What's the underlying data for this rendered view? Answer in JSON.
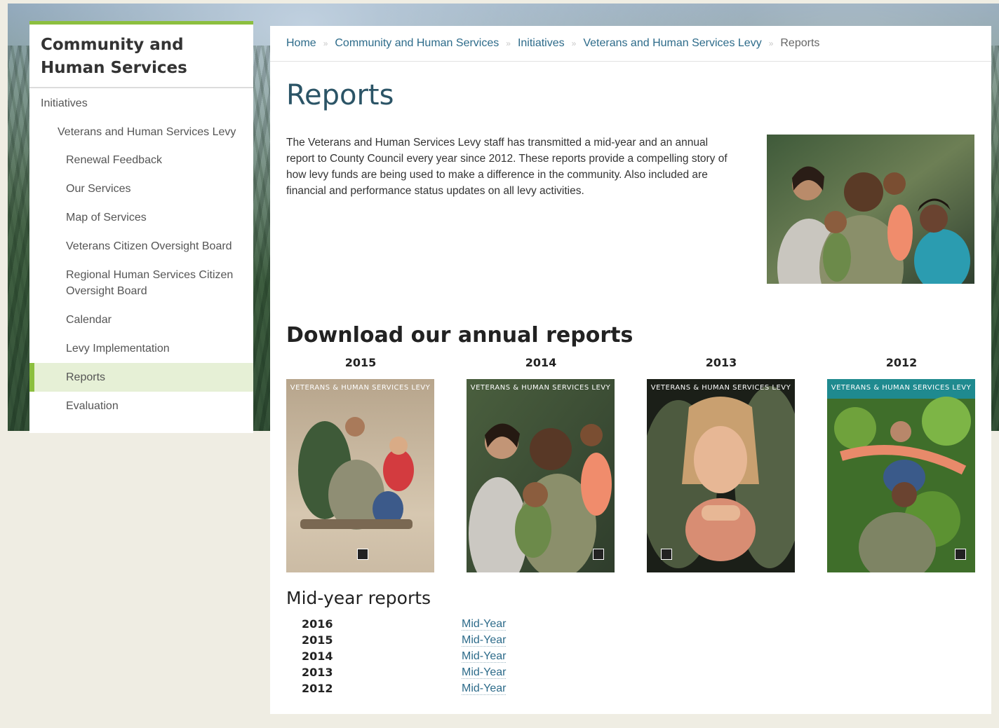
{
  "sidebar": {
    "title": "Community and Human Services",
    "items": [
      {
        "label": "Initiatives",
        "level": 1
      },
      {
        "label": "Veterans and Human Services Levy",
        "level": 2
      },
      {
        "label": "Renewal Feedback",
        "level": 3
      },
      {
        "label": "Our Services",
        "level": 3
      },
      {
        "label": "Map of Services",
        "level": 3
      },
      {
        "label": "Veterans Citizen Oversight Board",
        "level": 3
      },
      {
        "label": "Regional Human Services Citizen Oversight Board",
        "level": 3
      },
      {
        "label": "Calendar",
        "level": 3
      },
      {
        "label": "Levy Implementation",
        "level": 3
      },
      {
        "label": "Reports",
        "level": 3,
        "active": true
      },
      {
        "label": "Evaluation",
        "level": 3
      }
    ]
  },
  "breadcrumb": {
    "items": [
      "Home",
      "Community and Human Services",
      "Initiatives",
      "Veterans and Human Services Levy"
    ],
    "current": "Reports",
    "separator": "»"
  },
  "page": {
    "title": "Reports",
    "intro": "The Veterans and Human Services Levy staff has transmitted a mid-year and an annual report to County Council every year since 2012. These reports provide a compelling story of how levy funds are being used to make a difference in the community. Also included are financial and performance status updates on all levy activities."
  },
  "annual": {
    "heading": "Download our annual reports",
    "reports": [
      {
        "year": "2015",
        "cover_banner": "VETERANS & HUMAN SERVICES LEVY"
      },
      {
        "year": "2014",
        "cover_banner": "VETERANS & HUMAN SERVICES LEVY"
      },
      {
        "year": "2013",
        "cover_banner": "VETERANS & HUMAN SERVICES LEVY"
      },
      {
        "year": "2012",
        "cover_banner": "VETERANS & HUMAN SERVICES LEVY"
      }
    ]
  },
  "midyear": {
    "heading": "Mid-year reports",
    "rows": [
      {
        "year": "2016",
        "link": "Mid-Year"
      },
      {
        "year": "2015",
        "link": "Mid-Year"
      },
      {
        "year": "2014",
        "link": "Mid-Year"
      },
      {
        "year": "2013",
        "link": "Mid-Year"
      },
      {
        "year": "2012",
        "link": "Mid-Year"
      }
    ]
  },
  "colors": {
    "accent_green": "#8cbf3f",
    "link_blue": "#2d6b8a",
    "title_teal": "#2b5466",
    "page_bg": "#efede3"
  }
}
